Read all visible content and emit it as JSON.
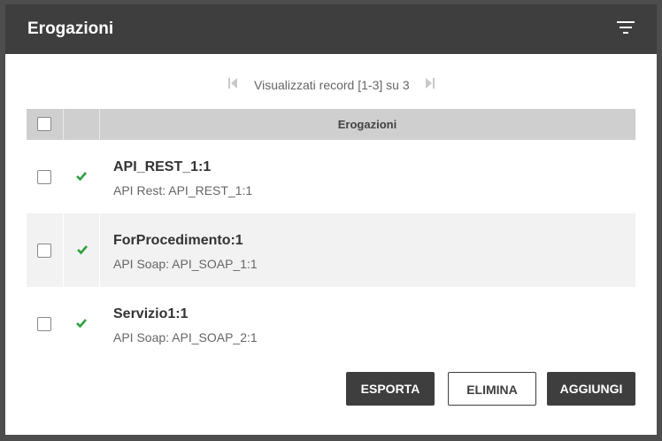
{
  "header": {
    "title": "Erogazioni",
    "filter_icon": "filter-icon"
  },
  "pager": {
    "text": "Visualizzati record [1-3] su 3",
    "first_icon": "skip-first-icon",
    "next_icon": "skip-last-icon"
  },
  "table": {
    "column_header": "Erogazioni",
    "rows": [
      {
        "title": "API_REST_1:1",
        "subtitle": "API Rest: API_REST_1:1",
        "status_icon": "check-icon",
        "status_color": "#2e9e3e"
      },
      {
        "title": "ForProcedimento:1",
        "subtitle": "API Soap: API_SOAP_1:1",
        "status_icon": "check-icon",
        "status_color": "#2e9e3e"
      },
      {
        "title": "Servizio1:1",
        "subtitle": "API Soap: API_SOAP_2:1",
        "status_icon": "check-icon",
        "status_color": "#2e9e3e"
      }
    ]
  },
  "actions": {
    "export_label": "ESPORTA",
    "delete_label": "ELIMINA",
    "add_label": "AGGIUNGI"
  },
  "colors": {
    "header_bg": "#3e3e3e",
    "table_header_bg": "#cfcfcf",
    "row_alt_bg": "#f2f2f2",
    "status_ok": "#2e9e3e"
  }
}
